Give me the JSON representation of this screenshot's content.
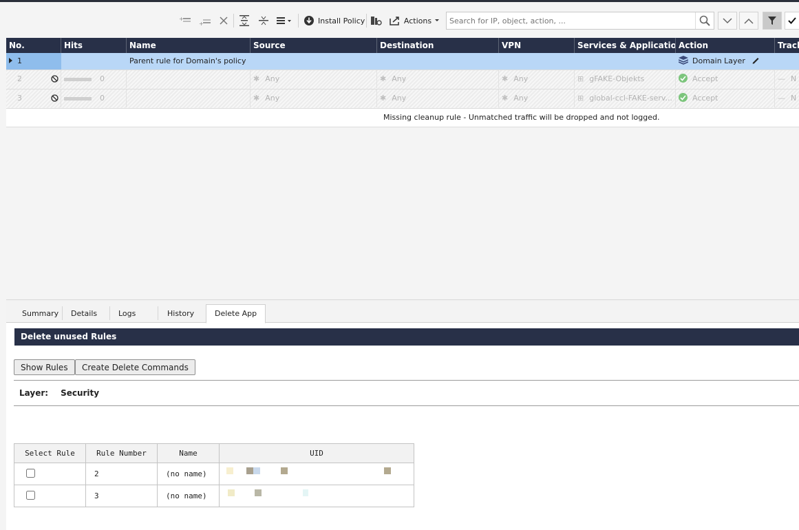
{
  "toolbar": {
    "install_policy": "Install Policy",
    "actions": "Actions",
    "search_placeholder": "Search for IP, object, action, ..."
  },
  "rules_table": {
    "columns": [
      "No.",
      "Hits",
      "Name",
      "Source",
      "Destination",
      "VPN",
      "Services & Applications",
      "Action",
      "Track"
    ],
    "rows": [
      {
        "no": "1",
        "name": "Parent rule for Domain's policy",
        "action": "Domain Layer"
      },
      {
        "no": "2",
        "hits": "0",
        "name": "",
        "source": "Any",
        "destination": "Any",
        "vpn": "Any",
        "services": "gFAKE-Objekts",
        "action": "Accept",
        "track": "N"
      },
      {
        "no": "3",
        "hits": "0",
        "name": "",
        "source": "Any",
        "destination": "Any",
        "vpn": "Any",
        "services": "global-ccl-FAKE-serv...",
        "action": "Accept",
        "track": "N"
      }
    ],
    "cleanup_message": "Missing cleanup rule - Unmatched traffic will be dropped and not logged."
  },
  "bottom_tabs": [
    "Summary",
    "Details",
    "Logs",
    "History",
    "Delete App"
  ],
  "delete_app": {
    "title": "Delete unused Rules",
    "show_rules": "Show Rules",
    "create_delete_commands": "Create Delete Commands",
    "layer_label": "Layer:",
    "layer_value": "Security",
    "table": {
      "headers": [
        "Select Rule",
        "Rule Number",
        "Name",
        "UID"
      ],
      "rows": [
        {
          "rule_number": "2",
          "name": "(no name)",
          "selected": false
        },
        {
          "rule_number": "3",
          "name": "(no name)",
          "selected": false
        }
      ]
    }
  },
  "colors": {
    "header_bg": "#283048",
    "selected_row": "#b9d7f7",
    "accept_green": "#7cc57c"
  }
}
